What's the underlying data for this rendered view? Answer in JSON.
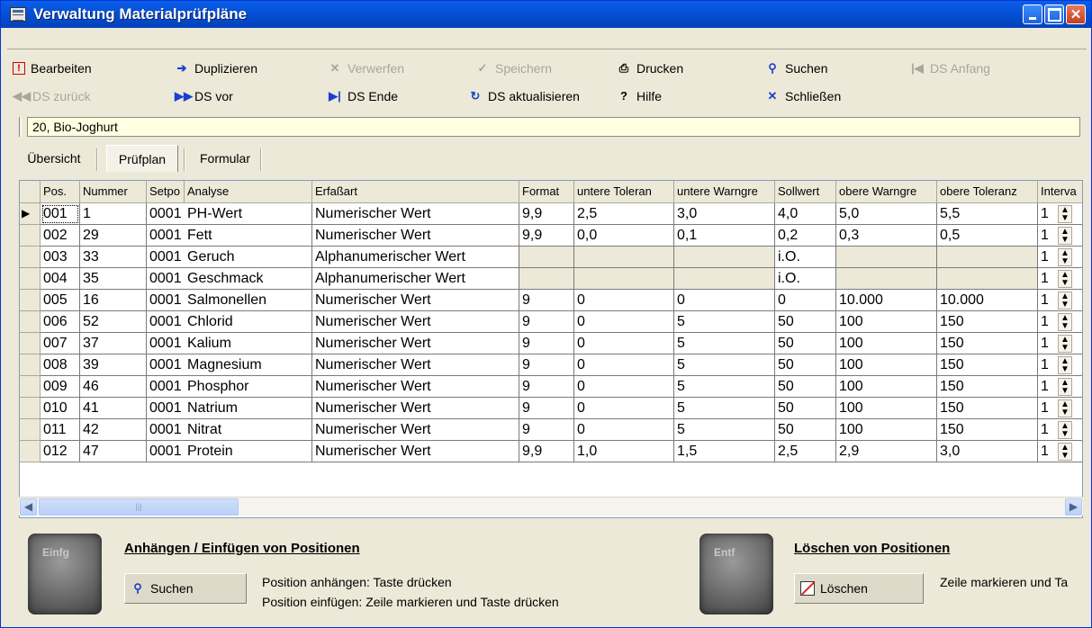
{
  "window": {
    "title": "Verwaltung Materialprüfpläne"
  },
  "toolbar": {
    "bearbeiten": "Bearbeiten",
    "duplizieren": "Duplizieren",
    "verwerfen": "Verwerfen",
    "speichern": "Speichern",
    "drucken": "Drucken",
    "suchen": "Suchen",
    "ds_anfang": "DS Anfang",
    "ds_zurueck": "DS zurück",
    "ds_vor": "DS vor",
    "ds_ende": "DS Ende",
    "ds_aktualisieren": "DS aktualisieren",
    "hilfe": "Hilfe",
    "schliessen": "Schließen"
  },
  "record": {
    "value": "20, Bio-Joghurt"
  },
  "tabs": {
    "uebersicht": "Übersicht",
    "pruefplan": "Prüfplan",
    "formular": "Formular"
  },
  "grid": {
    "columns": [
      "Pos.",
      "Nummer",
      "Setpo",
      "Analyse",
      "Erfaßart",
      "Format",
      "untere Toleran",
      "untere Warngre",
      "Sollwert",
      "obere Warngre",
      "obere Toleranz",
      "Interva"
    ],
    "rows": [
      {
        "pos": "001",
        "nummer": "1",
        "setpo": "0001",
        "analyse": "PH-Wert",
        "erfassart": "Numerischer Wert",
        "format": "9,9",
        "ut": "2,5",
        "uw": "3,0",
        "soll": "4,0",
        "ow": "5,0",
        "ot": "5,5",
        "intervall": "1"
      },
      {
        "pos": "002",
        "nummer": "29",
        "setpo": "0001",
        "analyse": "Fett",
        "erfassart": "Numerischer Wert",
        "format": "9,9",
        "ut": "0,0",
        "uw": "0,1",
        "soll": "0,2",
        "ow": "0,3",
        "ot": "0,5",
        "intervall": "1"
      },
      {
        "pos": "003",
        "nummer": "33",
        "setpo": "0001",
        "analyse": "Geruch",
        "erfassart": "Alphanumerischer Wert",
        "format": "",
        "ut": "",
        "uw": "",
        "soll": "i.O.",
        "ow": "",
        "ot": "",
        "intervall": "1"
      },
      {
        "pos": "004",
        "nummer": "35",
        "setpo": "0001",
        "analyse": "Geschmack",
        "erfassart": "Alphanumerischer Wert",
        "format": "",
        "ut": "",
        "uw": "",
        "soll": "i.O.",
        "ow": "",
        "ot": "",
        "intervall": "1"
      },
      {
        "pos": "005",
        "nummer": "16",
        "setpo": "0001",
        "analyse": "Salmonellen",
        "erfassart": "Numerischer Wert",
        "format": "9",
        "ut": "0",
        "uw": "0",
        "soll": "0",
        "ow": "10.000",
        "ot": "10.000",
        "intervall": "1"
      },
      {
        "pos": "006",
        "nummer": "52",
        "setpo": "0001",
        "analyse": "Chlorid",
        "erfassart": "Numerischer Wert",
        "format": "9",
        "ut": "0",
        "uw": "5",
        "soll": "50",
        "ow": "100",
        "ot": "150",
        "intervall": "1"
      },
      {
        "pos": "007",
        "nummer": "37",
        "setpo": "0001",
        "analyse": "Kalium",
        "erfassart": "Numerischer Wert",
        "format": "9",
        "ut": "0",
        "uw": "5",
        "soll": "50",
        "ow": "100",
        "ot": "150",
        "intervall": "1"
      },
      {
        "pos": "008",
        "nummer": "39",
        "setpo": "0001",
        "analyse": "Magnesium",
        "erfassart": "Numerischer Wert",
        "format": "9",
        "ut": "0",
        "uw": "5",
        "soll": "50",
        "ow": "100",
        "ot": "150",
        "intervall": "1"
      },
      {
        "pos": "009",
        "nummer": "46",
        "setpo": "0001",
        "analyse": "Phosphor",
        "erfassart": "Numerischer Wert",
        "format": "9",
        "ut": "0",
        "uw": "5",
        "soll": "50",
        "ow": "100",
        "ot": "150",
        "intervall": "1"
      },
      {
        "pos": "010",
        "nummer": "41",
        "setpo": "0001",
        "analyse": "Natrium",
        "erfassart": "Numerischer Wert",
        "format": "9",
        "ut": "0",
        "uw": "5",
        "soll": "50",
        "ow": "100",
        "ot": "150",
        "intervall": "1"
      },
      {
        "pos": "011",
        "nummer": "42",
        "setpo": "0001",
        "analyse": "Nitrat",
        "erfassart": "Numerischer Wert",
        "format": "9",
        "ut": "0",
        "uw": "5",
        "soll": "50",
        "ow": "100",
        "ot": "150",
        "intervall": "1"
      },
      {
        "pos": "012",
        "nummer": "47",
        "setpo": "0001",
        "analyse": "Protein",
        "erfassart": "Numerischer Wert",
        "format": "9,9",
        "ut": "1,0",
        "uw": "1,5",
        "soll": "2,5",
        "ow": "2,9",
        "ot": "3,0",
        "intervall": "1"
      }
    ]
  },
  "insert_section": {
    "key_label": "Einfg",
    "title": "Anhängen / Einfügen von Positionen",
    "button": "Suchen",
    "line1": "Position anhängen: Taste drücken",
    "line2": "Position einfügen: Zeile markieren und Taste drücken"
  },
  "delete_section": {
    "key_label": "Entf",
    "title": "Löschen von Positionen",
    "button": "Löschen",
    "line1": "Zeile markieren und Ta"
  },
  "colors": {
    "title_bar": "#0550D7",
    "window_bg": "#ECE9D8",
    "record_bg": "#FFFFE1",
    "accent_blue": "#1A3FD0",
    "delete_red": "#E02020"
  }
}
